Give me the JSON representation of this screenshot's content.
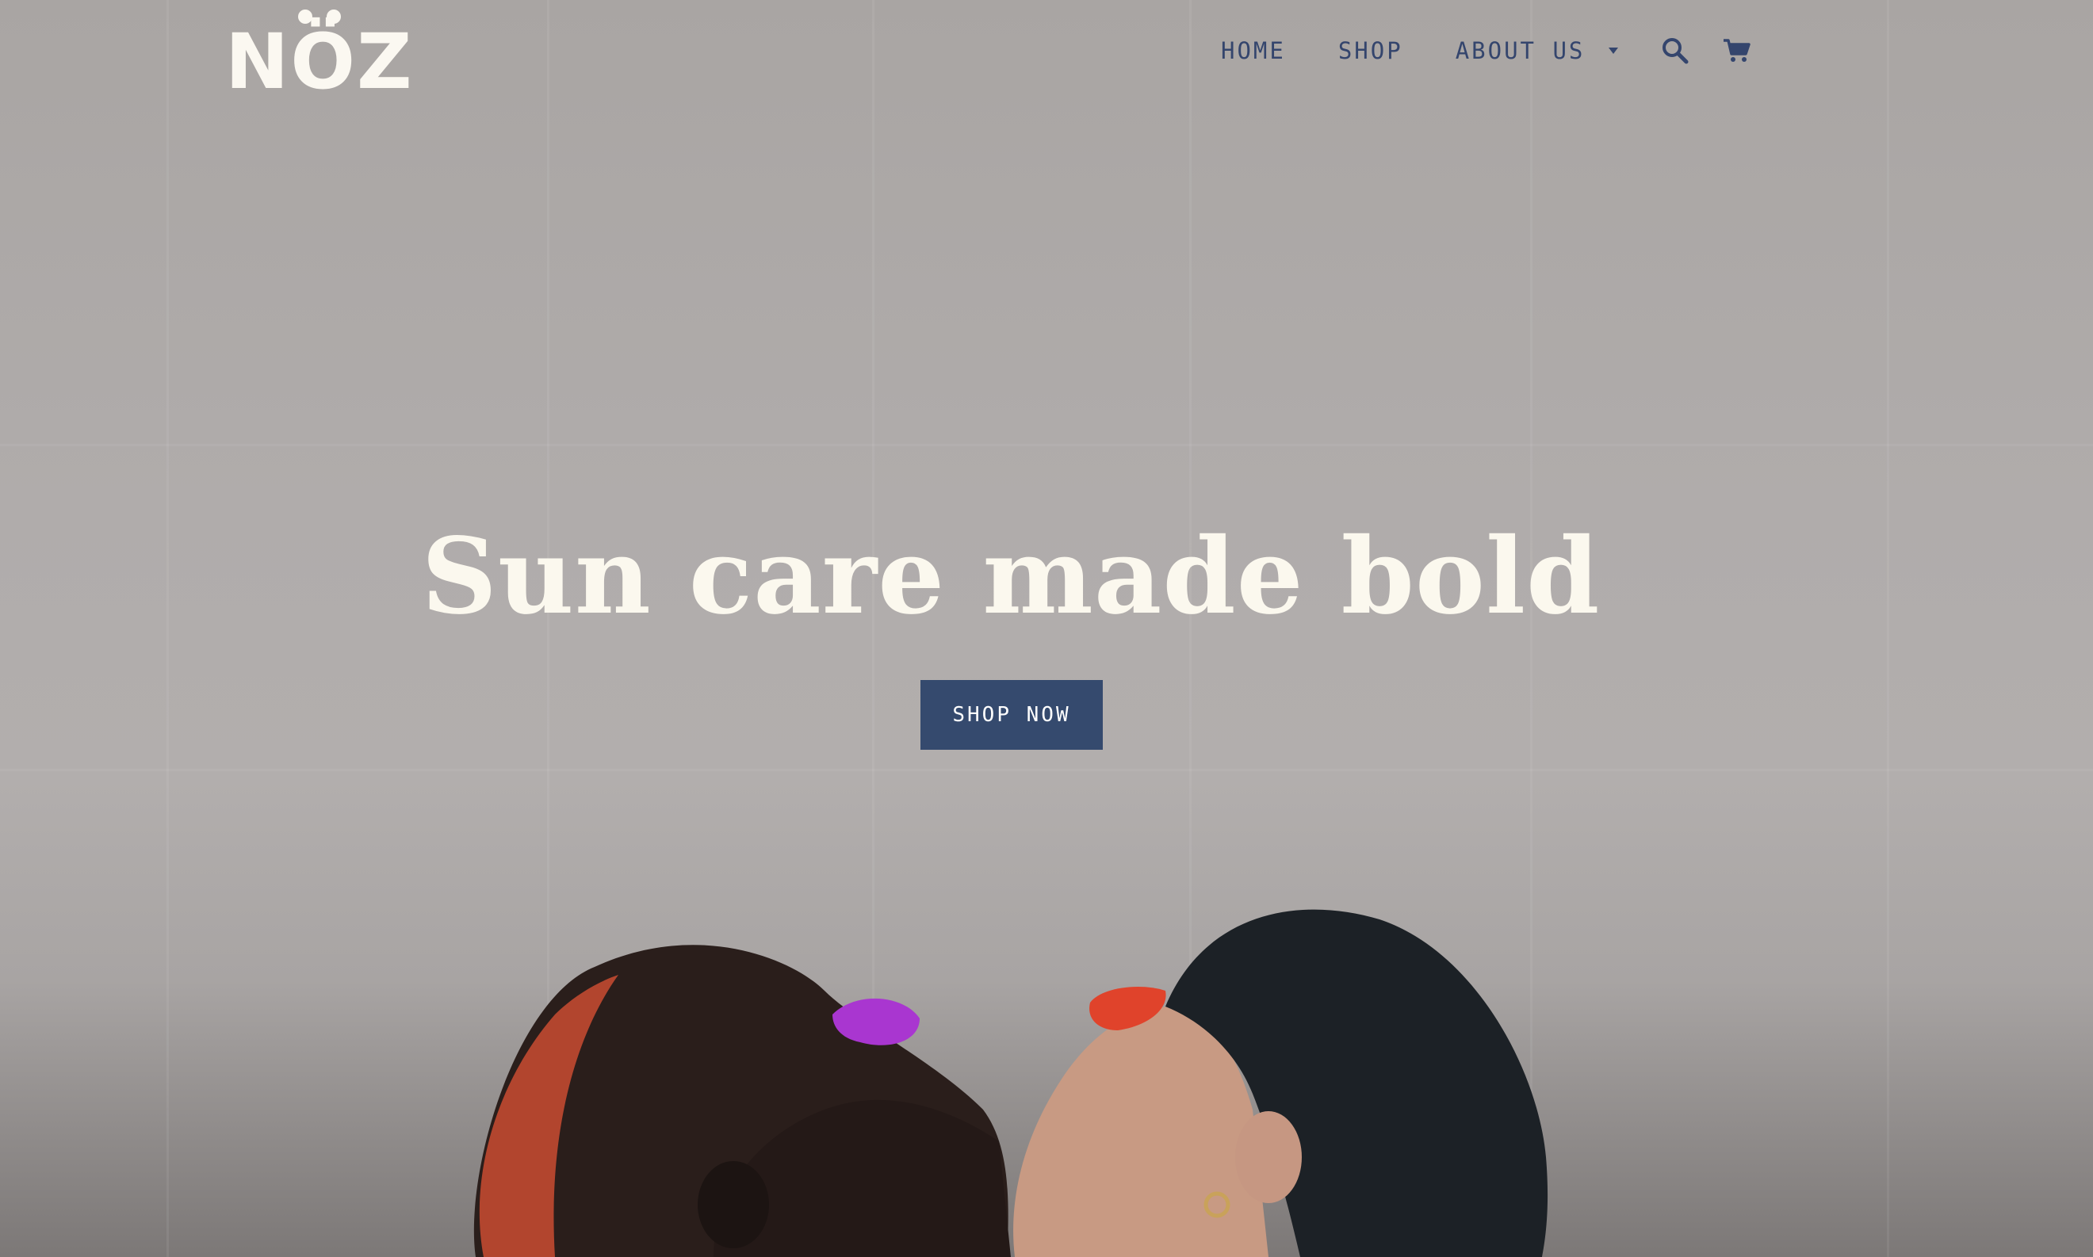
{
  "brand": {
    "logo_text": "NÖZ"
  },
  "nav": {
    "items": [
      {
        "label": "HOME"
      },
      {
        "label": "SHOP"
      },
      {
        "label": "ABOUT US"
      }
    ],
    "icons": [
      "search-icon",
      "cart-icon"
    ]
  },
  "hero": {
    "headline": "Sun care made bold",
    "cta_label": "SHOP NOW"
  },
  "colors": {
    "nav_text": "#34456d",
    "cta_background": "#354a6e",
    "logo": "#fbf8f1",
    "headline": "#fbf8ee",
    "background": "#b0acab"
  }
}
